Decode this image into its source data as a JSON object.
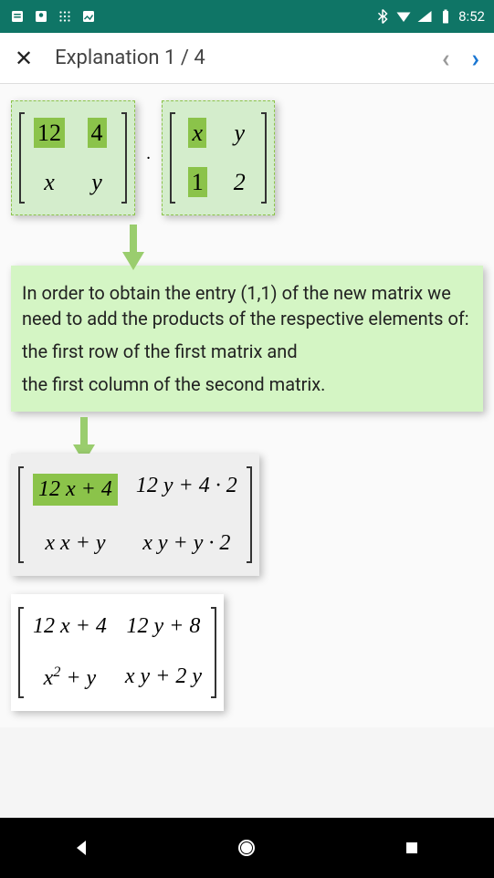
{
  "status": {
    "time": "8:52"
  },
  "appBar": {
    "title": "Explanation 1 / 4"
  },
  "matrix1": {
    "r1c1": "12",
    "r1c2": "4",
    "r2c1": "x",
    "r2c2": "y"
  },
  "matrix2": {
    "r1c1": "x",
    "r1c2": "y",
    "r2c1": "1",
    "r2c2": "2"
  },
  "explanation": {
    "p1": "In order to obtain the entry (1,1) of the new matrix we need to add the products of the respective elements of:",
    "p2": "the first row of the first matrix and",
    "p3": "the first column of the second matrix."
  },
  "result": {
    "r1c1": "12 x + 4",
    "r1c2": "12 y + 4 · 2",
    "r2c1": "x x + y",
    "r2c2": "x y + y · 2"
  },
  "final": {
    "r1c1_a": "12 x + 4",
    "r1c2_a": "12 y + 8",
    "r2c1_base": "x",
    "r2c1_sup": "2",
    "r2c1_rest": " + y",
    "r2c2": "x y + 2 y"
  }
}
